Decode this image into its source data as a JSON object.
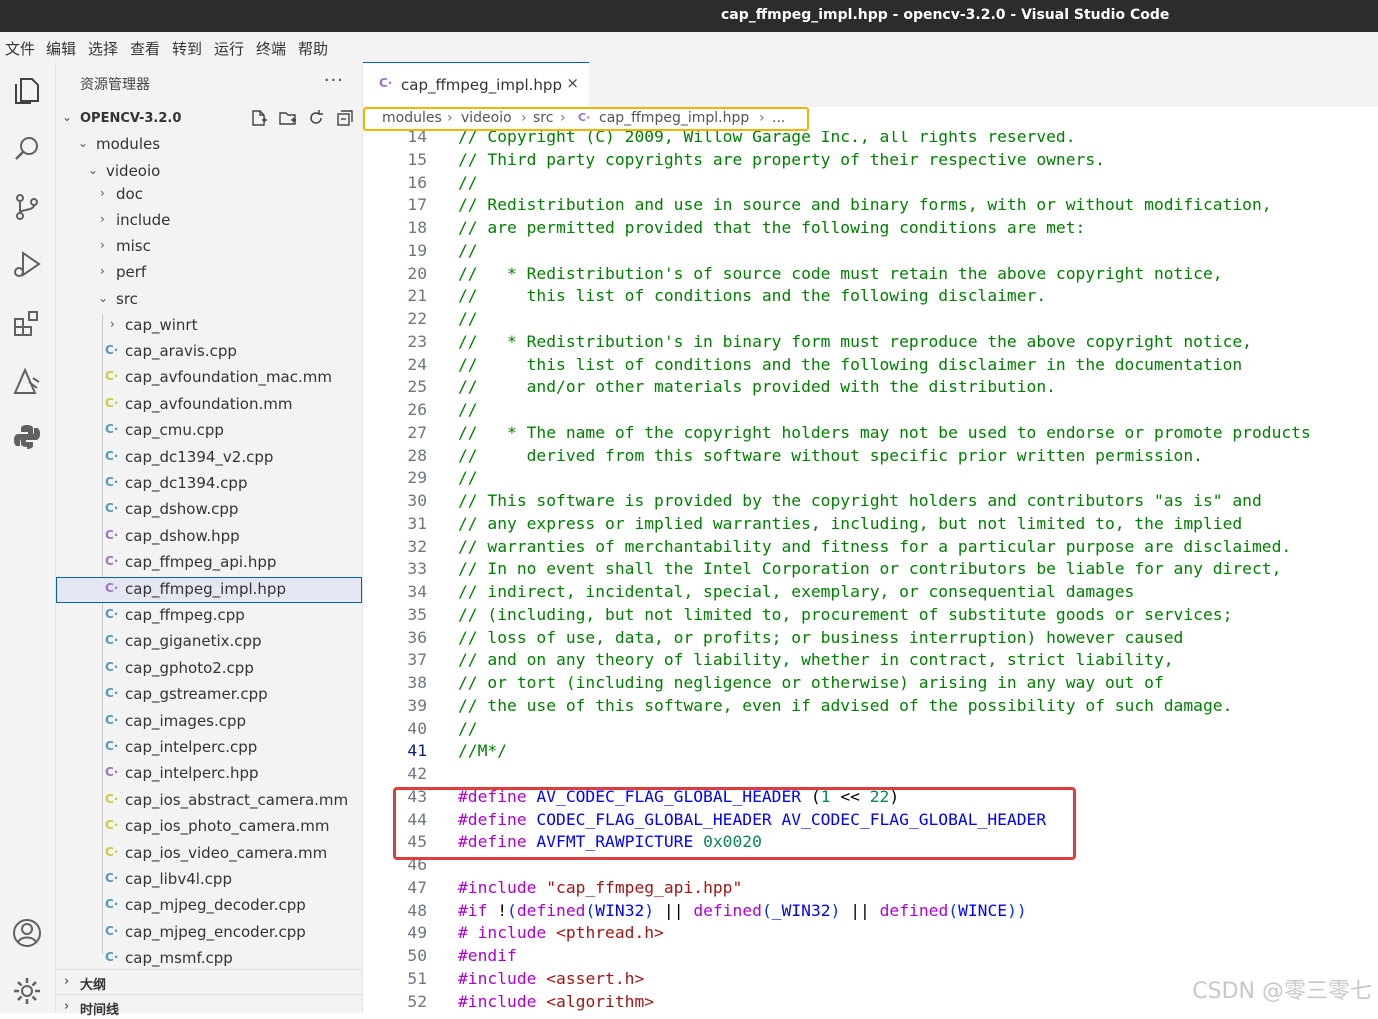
{
  "window": {
    "title": "cap_ffmpeg_impl.hpp - opencv-3.2.0 - Visual Studio Code"
  },
  "menu": [
    "文件",
    "编辑",
    "选择",
    "查看",
    "转到",
    "运行",
    "终端",
    "帮助"
  ],
  "activity_bar": [
    "explorer-icon",
    "search-icon",
    "source-control-icon",
    "run-debug-icon",
    "extensions-icon",
    "remote-icon",
    "python-icon",
    "account-icon",
    "settings-gear-icon"
  ],
  "sidebar": {
    "header": "资源管理器",
    "more": "···",
    "workspace": "OPENCV-3.2.0",
    "folders": {
      "modules": "modules",
      "videoio": "videoio",
      "doc": "doc",
      "include": "include",
      "misc": "misc",
      "perf": "perf",
      "src": "src",
      "cap_winrt": "cap_winrt"
    },
    "files": [
      {
        "name": "cap_aravis.cpp",
        "kind": "cpp"
      },
      {
        "name": "cap_avfoundation_mac.mm",
        "kind": "mm"
      },
      {
        "name": "cap_avfoundation.mm",
        "kind": "mm"
      },
      {
        "name": "cap_cmu.cpp",
        "kind": "cpp"
      },
      {
        "name": "cap_dc1394_v2.cpp",
        "kind": "cpp"
      },
      {
        "name": "cap_dc1394.cpp",
        "kind": "cpp"
      },
      {
        "name": "cap_dshow.cpp",
        "kind": "cpp"
      },
      {
        "name": "cap_dshow.hpp",
        "kind": "hpp"
      },
      {
        "name": "cap_ffmpeg_api.hpp",
        "kind": "hpp"
      },
      {
        "name": "cap_ffmpeg_impl.hpp",
        "kind": "hpp"
      },
      {
        "name": "cap_ffmpeg.cpp",
        "kind": "cpp"
      },
      {
        "name": "cap_giganetix.cpp",
        "kind": "cpp"
      },
      {
        "name": "cap_gphoto2.cpp",
        "kind": "cpp"
      },
      {
        "name": "cap_gstreamer.cpp",
        "kind": "cpp"
      },
      {
        "name": "cap_images.cpp",
        "kind": "cpp"
      },
      {
        "name": "cap_intelperc.cpp",
        "kind": "cpp"
      },
      {
        "name": "cap_intelperc.hpp",
        "kind": "hpp"
      },
      {
        "name": "cap_ios_abstract_camera.mm",
        "kind": "mm"
      },
      {
        "name": "cap_ios_photo_camera.mm",
        "kind": "mm"
      },
      {
        "name": "cap_ios_video_camera.mm",
        "kind": "mm"
      },
      {
        "name": "cap_libv4l.cpp",
        "kind": "cpp"
      },
      {
        "name": "cap_mjpeg_decoder.cpp",
        "kind": "cpp"
      },
      {
        "name": "cap_mjpeg_encoder.cpp",
        "kind": "cpp"
      },
      {
        "name": "cap_msmf.cpp",
        "kind": "cpp"
      }
    ],
    "selected_file": "cap_ffmpeg_impl.hpp",
    "outline": "大纲",
    "timeline": "时间线"
  },
  "tab": {
    "label": "cap_ffmpeg_impl.hpp",
    "close": "×"
  },
  "breadcrumbs": [
    "modules",
    "videoio",
    "src",
    "cap_ffmpeg_impl.hpp",
    "..."
  ],
  "editor": {
    "active_line": 41,
    "lines": [
      {
        "n": "14",
        "t": "// Copyright (C) 2009, Willow Garage Inc., all rights reserved."
      },
      {
        "n": "15",
        "t": "// Third party copyrights are property of their respective owners."
      },
      {
        "n": "16",
        "t": "//"
      },
      {
        "n": "17",
        "t": "// Redistribution and use in source and binary forms, with or without modification,"
      },
      {
        "n": "18",
        "t": "// are permitted provided that the following conditions are met:"
      },
      {
        "n": "19",
        "t": "//"
      },
      {
        "n": "20",
        "t": "//   * Redistribution's of source code must retain the above copyright notice,"
      },
      {
        "n": "21",
        "t": "//     this list of conditions and the following disclaimer."
      },
      {
        "n": "22",
        "t": "//"
      },
      {
        "n": "23",
        "t": "//   * Redistribution's in binary form must reproduce the above copyright notice,"
      },
      {
        "n": "24",
        "t": "//     this list of conditions and the following disclaimer in the documentation"
      },
      {
        "n": "25",
        "t": "//     and/or other materials provided with the distribution."
      },
      {
        "n": "26",
        "t": "//"
      },
      {
        "n": "27",
        "t": "//   * The name of the copyright holders may not be used to endorse or promote products"
      },
      {
        "n": "28",
        "t": "//     derived from this software without specific prior written permission."
      },
      {
        "n": "29",
        "t": "//"
      },
      {
        "n": "30",
        "t": "// This software is provided by the copyright holders and contributors \"as is\" and"
      },
      {
        "n": "31",
        "t": "// any express or implied warranties, including, but not limited to, the implied"
      },
      {
        "n": "32",
        "t": "// warranties of merchantability and fitness for a particular purpose are disclaimed."
      },
      {
        "n": "33",
        "t": "// In no event shall the Intel Corporation or contributors be liable for any direct,"
      },
      {
        "n": "34",
        "t": "// indirect, incidental, special, exemplary, or consequential damages"
      },
      {
        "n": "35",
        "t": "// (including, but not limited to, procurement of substitute goods or services;"
      },
      {
        "n": "36",
        "t": "// loss of use, data, or profits; or business interruption) however caused"
      },
      {
        "n": "37",
        "t": "// and on any theory of liability, whether in contract, strict liability,"
      },
      {
        "n": "38",
        "t": "// or tort (including negligence or otherwise) arising in any way out of"
      },
      {
        "n": "39",
        "t": "// the use of this software, even if advised of the possibility of such damage."
      },
      {
        "n": "40",
        "t": "//"
      },
      {
        "n": "41",
        "t": "//M*/"
      },
      {
        "n": "42",
        "t": ""
      },
      {
        "n": "43",
        "parts": [
          [
            "pp",
            "#define "
          ],
          [
            "mac",
            "AV_CODEC_FLAG_GLOBAL_HEADER "
          ],
          [
            "txt",
            "("
          ],
          [
            "num",
            "1"
          ],
          [
            "txt",
            " << "
          ],
          [
            "num",
            "22"
          ],
          [
            "txt",
            ")"
          ]
        ]
      },
      {
        "n": "44",
        "parts": [
          [
            "pp",
            "#define "
          ],
          [
            "mac",
            "CODEC_FLAG_GLOBAL_HEADER AV_CODEC_FLAG_GLOBAL_HEADER"
          ]
        ]
      },
      {
        "n": "45",
        "parts": [
          [
            "pp",
            "#define "
          ],
          [
            "mac",
            "AVFMT_RAWPICTURE "
          ],
          [
            "num",
            "0x0020"
          ]
        ]
      },
      {
        "n": "46",
        "t": ""
      },
      {
        "n": "47",
        "parts": [
          [
            "pp",
            "#include "
          ],
          [
            "str",
            "\"cap_ffmpeg_api.hpp\""
          ]
        ]
      },
      {
        "n": "48",
        "parts": [
          [
            "pp",
            "#if "
          ],
          [
            "txt",
            "!"
          ],
          [
            "br",
            "("
          ],
          [
            "fn",
            "defined"
          ],
          [
            "br",
            "("
          ],
          [
            "mac",
            "WIN32"
          ],
          [
            "br",
            ")"
          ],
          [
            "txt",
            " || "
          ],
          [
            "fn",
            "defined"
          ],
          [
            "br",
            "("
          ],
          [
            "mac",
            "_WIN32"
          ],
          [
            "br",
            ")"
          ],
          [
            "txt",
            " || "
          ],
          [
            "fn",
            "defined"
          ],
          [
            "br",
            "("
          ],
          [
            "mac",
            "WINCE"
          ],
          [
            "br",
            "))"
          ]
        ]
      },
      {
        "n": "49",
        "parts": [
          [
            "pp",
            "# include "
          ],
          [
            "str",
            "<pthread.h>"
          ]
        ]
      },
      {
        "n": "50",
        "parts": [
          [
            "pp",
            "#endif"
          ]
        ]
      },
      {
        "n": "51",
        "parts": [
          [
            "pp",
            "#include "
          ],
          [
            "str",
            "<assert.h>"
          ]
        ]
      },
      {
        "n": "52",
        "parts": [
          [
            "pp",
            "#include "
          ],
          [
            "str",
            "<algorithm>"
          ]
        ]
      }
    ]
  },
  "watermark": "CSDN @零三零七",
  "colors": {
    "accent": "#005fb8",
    "breadcrumb_highlight": "#f4b400",
    "code_highlight_box": "#e03c3c",
    "comment": "#008000",
    "macro": "#0000ff",
    "directive": "#af00db"
  }
}
